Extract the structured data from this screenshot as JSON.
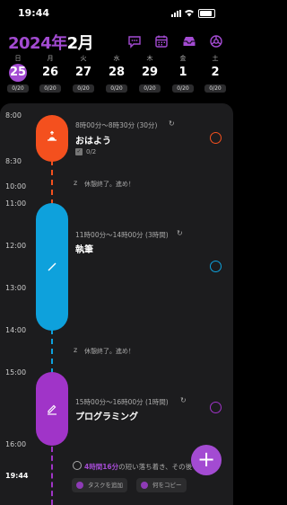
{
  "status_bar": {
    "time": "19:44"
  },
  "header": {
    "year": "2024",
    "year_suffix": "年",
    "month": "2月"
  },
  "week": [
    {
      "weekday": "日",
      "date": "25",
      "count": "0/20",
      "selected": true
    },
    {
      "weekday": "月",
      "date": "26",
      "count": "0/20"
    },
    {
      "weekday": "火",
      "date": "27",
      "count": "0/20"
    },
    {
      "weekday": "水",
      "date": "28",
      "count": "0/20"
    },
    {
      "weekday": "木",
      "date": "29",
      "count": "0/20"
    },
    {
      "weekday": "金",
      "date": "1",
      "count": "0/20"
    },
    {
      "weekday": "土",
      "date": "2",
      "count": "0/20"
    }
  ],
  "timeline": {
    "labels": [
      "8:00",
      "8:30",
      "10:00",
      "11:00",
      "12:00",
      "13:00",
      "14:00",
      "15:00",
      "16:00",
      "19:44"
    ],
    "tasks": [
      {
        "time": "8時00分～8時30分 (30分)",
        "title": "おはよう",
        "subtasks": "0/2",
        "color": "#f4501e"
      },
      {
        "time": "11時00分～14時00分 (3時間)",
        "title": "執筆",
        "color": "#0ea1dc"
      },
      {
        "time": "15時00分～16時00分 (1時間)",
        "title": "プログラミング",
        "color": "#a034c8"
      }
    ],
    "breaks": [
      "休憩終了。進め！",
      "休憩終了。進め！"
    ]
  },
  "footer": {
    "free_time_value": "4時間16分",
    "free_time_text": "の短い落ち着き、その後",
    "add_task_label": "タスクを追加",
    "copy_label": "何をコピー"
  },
  "colors": {
    "accent": "#a34bd2",
    "background": "#1c1c1e"
  }
}
